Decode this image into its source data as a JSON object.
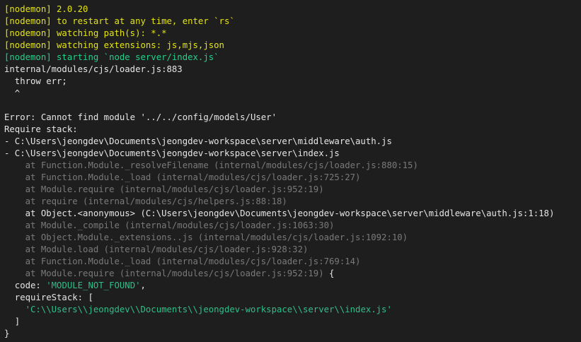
{
  "terminal": {
    "colors": {
      "background": "#1e1e1e",
      "yellow": "#e5e510",
      "green": "#23d18b",
      "white": "#e6e6e6",
      "gray": "#7a7a7a",
      "string": "#2fbf8a"
    },
    "lines": [
      {
        "text": "[nodemon] 2.0.20",
        "color": "yellow"
      },
      {
        "text": "[nodemon] to restart at any time, enter `rs`",
        "color": "yellow"
      },
      {
        "text": "[nodemon] watching path(s): *.*",
        "color": "yellow"
      },
      {
        "text": "[nodemon] watching extensions: js,mjs,json",
        "color": "yellow"
      },
      {
        "text": "[nodemon] starting `node server/index.js`",
        "color": "green"
      },
      {
        "text": "internal/modules/cjs/loader.js:883",
        "color": "white"
      },
      {
        "text": "  throw err;",
        "color": "white"
      },
      {
        "text": "  ^",
        "color": "white"
      },
      {
        "text": "",
        "color": "white"
      },
      {
        "text": "Error: Cannot find module '../../config/models/User'",
        "color": "white"
      },
      {
        "text": "Require stack:",
        "color": "white"
      },
      {
        "text": "- C:\\Users\\jeongdev\\Documents\\jeongdev-workspace\\server\\middleware\\auth.js",
        "color": "white"
      },
      {
        "text": "- C:\\Users\\jeongdev\\Documents\\jeongdev-workspace\\server\\index.js",
        "color": "white"
      },
      {
        "text": "    at Function.Module._resolveFilename (internal/modules/cjs/loader.js:880:15)",
        "color": "gray"
      },
      {
        "text": "    at Function.Module._load (internal/modules/cjs/loader.js:725:27)",
        "color": "gray"
      },
      {
        "text": "    at Module.require (internal/modules/cjs/loader.js:952:19)",
        "color": "gray"
      },
      {
        "text": "    at require (internal/modules/cjs/helpers.js:88:18)",
        "color": "gray"
      },
      {
        "text": "    at Object.<anonymous> (C:\\Users\\jeongdev\\Documents\\jeongdev-workspace\\server\\middleware\\auth.js:1:18)",
        "color": "white"
      },
      {
        "text": "    at Module._compile (internal/modules/cjs/loader.js:1063:30)",
        "color": "gray"
      },
      {
        "text": "    at Object.Module._extensions..js (internal/modules/cjs/loader.js:1092:10)",
        "color": "gray"
      },
      {
        "text": "    at Module.load (internal/modules/cjs/loader.js:928:32)",
        "color": "gray"
      },
      {
        "text": "    at Function.Module._load (internal/modules/cjs/loader.js:769:14)",
        "color": "gray"
      },
      {
        "segments": [
          {
            "text": "    at Module.require (internal/modules/cjs/loader.js:952:19)",
            "color": "gray"
          },
          {
            "text": " {",
            "color": "white"
          }
        ]
      },
      {
        "segments": [
          {
            "text": "  code: ",
            "color": "white"
          },
          {
            "text": "'MODULE_NOT_FOUND'",
            "color": "string"
          },
          {
            "text": ",",
            "color": "white"
          }
        ]
      },
      {
        "text": "  requireStack: [",
        "color": "white"
      },
      {
        "segments": [
          {
            "text": "    ",
            "color": "white"
          },
          {
            "text": "'C:\\\\Users\\\\jeongdev\\\\Documents\\\\jeongdev-workspace\\\\server\\\\index.js'",
            "color": "string"
          }
        ]
      },
      {
        "text": "  ]",
        "color": "white"
      },
      {
        "text": "}",
        "color": "white"
      }
    ]
  }
}
